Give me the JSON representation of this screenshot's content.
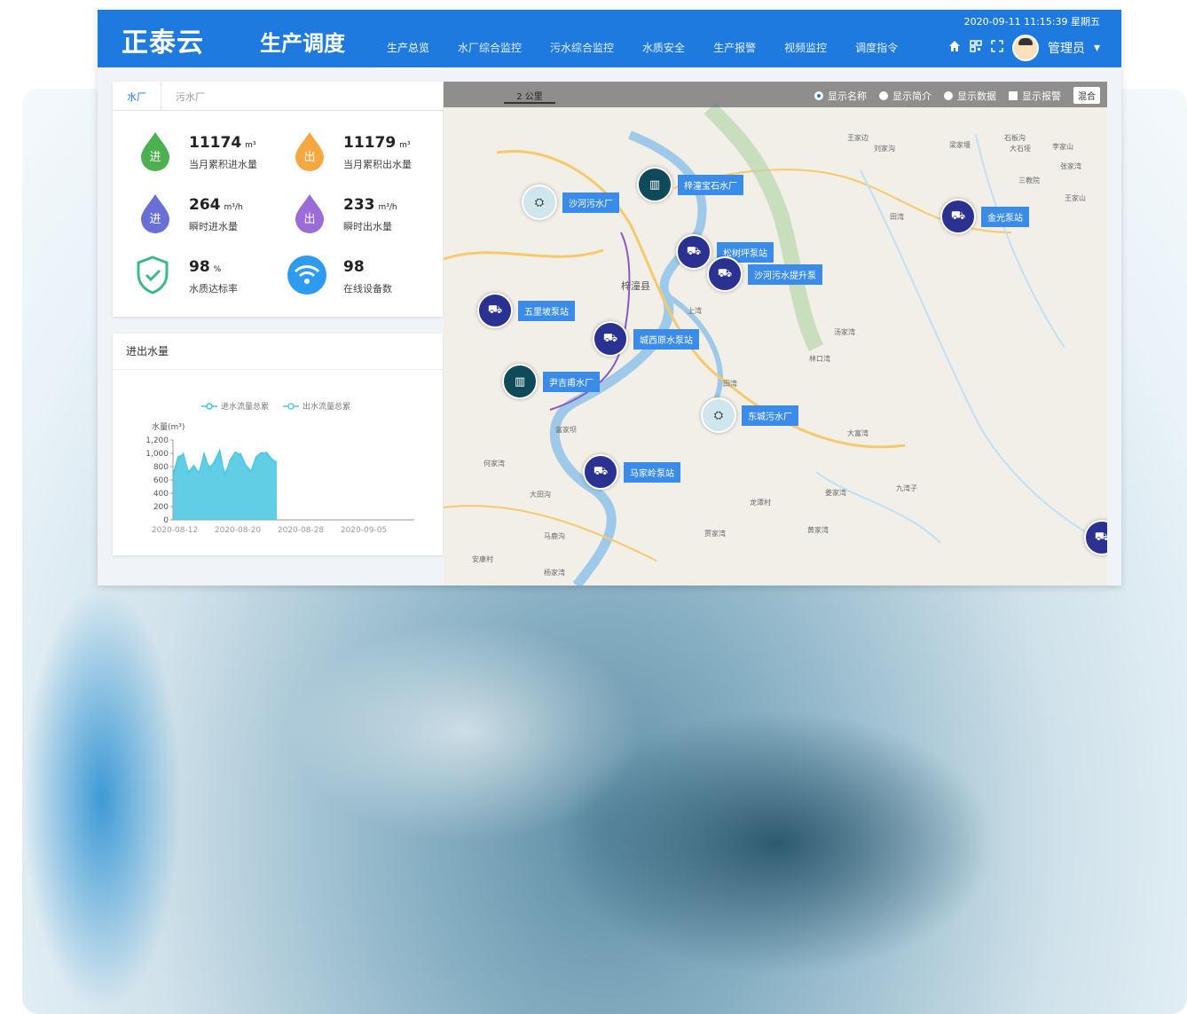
{
  "header": {
    "logo": "正泰云",
    "subtitle": "生产调度",
    "datetime": "2020-09-11 11:15:39 星期五",
    "username": "管理员",
    "nav": [
      {
        "label": "生产总览",
        "active": true
      },
      {
        "label": "水厂综合监控",
        "active": false
      },
      {
        "label": "污水综合监控",
        "active": false
      },
      {
        "label": "水质安全",
        "active": false
      },
      {
        "label": "生产报警",
        "active": false
      },
      {
        "label": "视频监控",
        "active": false
      },
      {
        "label": "调度指令",
        "active": false
      }
    ],
    "icons": [
      "home-icon",
      "qrcode-icon",
      "fullscreen-icon",
      "avatar",
      "caret-down-icon"
    ]
  },
  "stats_panel": {
    "tabs": [
      {
        "label": "水厂",
        "active": true
      },
      {
        "label": "污水厂",
        "active": false
      }
    ],
    "stats": [
      {
        "value": "11174",
        "unit": "m³",
        "label": "当月累积进水量",
        "icon": "进",
        "color": "#4caf50"
      },
      {
        "value": "11179",
        "unit": "m³",
        "label": "当月累积出水量",
        "icon": "出",
        "color": "#f5a742"
      },
      {
        "value": "264",
        "unit": "m³/h",
        "label": "瞬时进水量",
        "icon": "进",
        "color": "#6a6fd8"
      },
      {
        "value": "233",
        "unit": "m³/h",
        "label": "瞬时出水量",
        "icon": "出",
        "color": "#9b6bd6"
      },
      {
        "value": "98",
        "unit": "%",
        "label": "水质达标率",
        "icon": "shield-icon",
        "color": "#3db88a"
      },
      {
        "value": "98",
        "unit": "",
        "label": "在线设备数",
        "icon": "wifi-icon",
        "color": "#2d9cf0"
      }
    ]
  },
  "chart_panel": {
    "title": "进出水量"
  },
  "chart_data": {
    "type": "area",
    "ylabel": "水量(m³)",
    "ylim": [
      0,
      1200
    ],
    "yticks": [
      "0",
      "200",
      "400",
      "600",
      "800",
      "1,000",
      "1,200"
    ],
    "xticks": [
      "2020-08-12",
      "2020-08-20",
      "2020-08-28",
      "2020-09-05"
    ],
    "legend": "top",
    "series": [
      {
        "name": "进水流量总累",
        "color": "#3ec6d8",
        "values": [
          680,
          950,
          980,
          720,
          820,
          700,
          1000,
          760,
          880,
          1050,
          650,
          900,
          1020,
          980,
          800,
          720,
          950,
          1010,
          1000,
          900,
          850
        ]
      },
      {
        "name": "出水流量总累",
        "color": "#55c8e8",
        "values": [
          620,
          900,
          1000,
          700,
          780,
          720,
          950,
          800,
          850,
          980,
          700,
          880,
          950,
          1000,
          830,
          740,
          920,
          980,
          1020,
          920,
          870
        ]
      }
    ]
  },
  "map": {
    "scale": "2 公里",
    "options": [
      {
        "label": "显示名称",
        "type": "radio",
        "on": true
      },
      {
        "label": "显示简介",
        "type": "radio",
        "on": false
      },
      {
        "label": "显示数据",
        "type": "radio",
        "on": false
      },
      {
        "label": "显示报警",
        "type": "checkbox",
        "on": false
      }
    ],
    "layer_button": "混合",
    "markers": [
      {
        "name": "梓潼宝石水厂",
        "kind": "plant"
      },
      {
        "name": "沙河污水厂",
        "kind": "sew"
      },
      {
        "name": "金光泵站",
        "kind": "pump"
      },
      {
        "name": "松树坪泵站",
        "kind": "pump"
      },
      {
        "name": "沙河污水提升泵",
        "kind": "pump"
      },
      {
        "name": "五里坡泵站",
        "kind": "pump"
      },
      {
        "name": "城西原水泵站",
        "kind": "pump"
      },
      {
        "name": "尹吉甫水厂",
        "kind": "plant"
      },
      {
        "name": "东城污水厂",
        "kind": "sew"
      },
      {
        "name": "马家岭泵站",
        "kind": "pump"
      }
    ],
    "places": [
      "梓潼县",
      "王家边",
      "刘家沟",
      "梁家堰",
      "石板沟",
      "大石垭",
      "李家山",
      "张家湾",
      "三教院",
      "王家山",
      "田湾",
      "上湾",
      "林口湾",
      "汤家湾",
      "田湾",
      "大富湾",
      "九湾子",
      "龙潭村",
      "姜家湾",
      "贾家湾",
      "黄家湾",
      "马鹿沟",
      "杨家湾",
      "大田沟",
      "何家湾",
      "安康村",
      "富家坝"
    ]
  }
}
